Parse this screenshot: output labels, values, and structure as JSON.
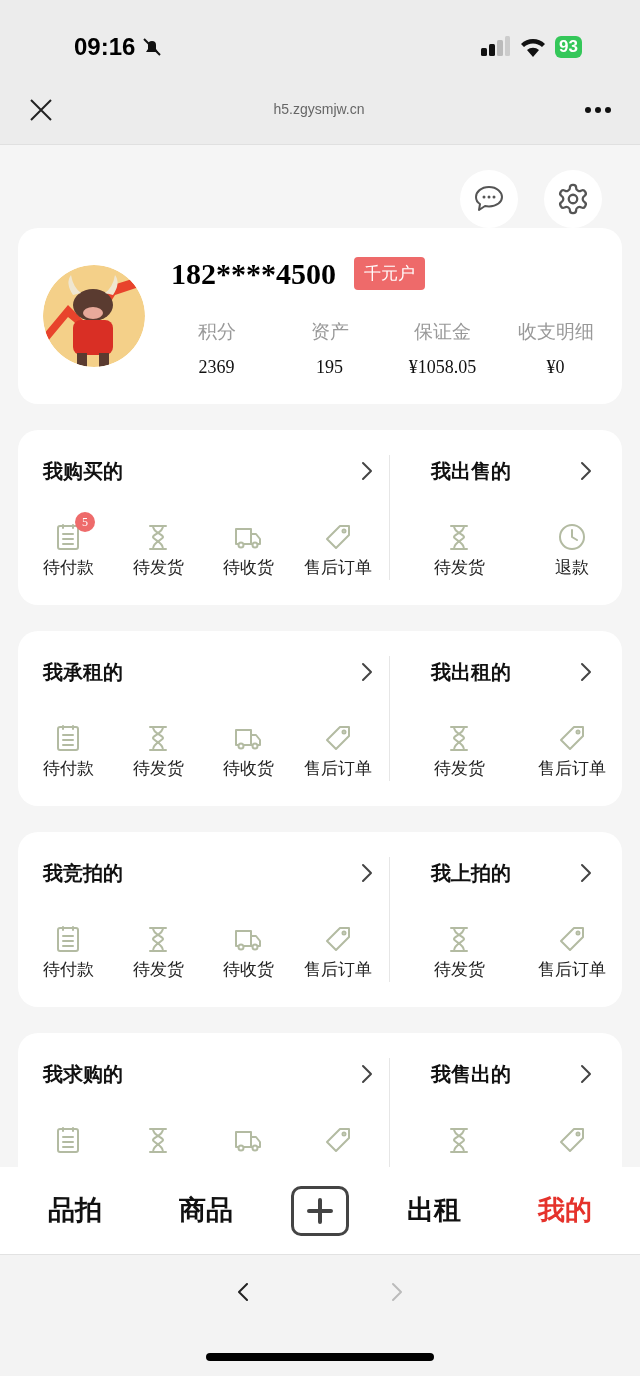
{
  "status_bar": {
    "time": "09:16",
    "battery": "93"
  },
  "browser": {
    "url": "h5.zgysmjw.cn"
  },
  "profile": {
    "name": "182****4500",
    "badge": "千元户",
    "stats": [
      {
        "label": "积分",
        "value": "2369"
      },
      {
        "label": "资产",
        "value": "195"
      },
      {
        "label": "保证金",
        "value": "¥1058.05"
      },
      {
        "label": "收支明细",
        "value": "¥0"
      }
    ]
  },
  "cards": [
    {
      "left": {
        "title": "我购买的",
        "items": [
          {
            "kind": "list",
            "label": "待付款",
            "badge": "5"
          },
          {
            "kind": "hourglass",
            "label": "待发货"
          },
          {
            "kind": "truck",
            "label": "待收货"
          },
          {
            "kind": "tag",
            "label": "售后订单"
          }
        ]
      },
      "right": {
        "title": "我出售的",
        "items": [
          {
            "kind": "hourglass",
            "label": "待发货"
          },
          {
            "kind": "clock",
            "label": "退款"
          }
        ]
      }
    },
    {
      "left": {
        "title": "我承租的",
        "items": [
          {
            "kind": "list",
            "label": "待付款"
          },
          {
            "kind": "hourglass",
            "label": "待发货"
          },
          {
            "kind": "truck",
            "label": "待收货"
          },
          {
            "kind": "tag",
            "label": "售后订单"
          }
        ]
      },
      "right": {
        "title": "我出租的",
        "items": [
          {
            "kind": "hourglass",
            "label": "待发货"
          },
          {
            "kind": "tag",
            "label": "售后订单"
          }
        ]
      }
    },
    {
      "left": {
        "title": "我竞拍的",
        "items": [
          {
            "kind": "list",
            "label": "待付款"
          },
          {
            "kind": "hourglass",
            "label": "待发货"
          },
          {
            "kind": "truck",
            "label": "待收货"
          },
          {
            "kind": "tag",
            "label": "售后订单"
          }
        ]
      },
      "right": {
        "title": "我上拍的",
        "items": [
          {
            "kind": "hourglass",
            "label": "待发货"
          },
          {
            "kind": "tag",
            "label": "售后订单"
          }
        ]
      }
    },
    {
      "left": {
        "title": "我求购的",
        "items": [
          {
            "kind": "list"
          },
          {
            "kind": "hourglass"
          },
          {
            "kind": "truck"
          },
          {
            "kind": "tag"
          }
        ]
      },
      "right": {
        "title": "我售出的",
        "items": [
          {
            "kind": "hourglass"
          },
          {
            "kind": "tag"
          }
        ]
      }
    }
  ],
  "tab_bar": [
    {
      "kind": "text",
      "label": "品拍",
      "selected": false
    },
    {
      "kind": "text",
      "label": "商品",
      "selected": false
    },
    {
      "kind": "add",
      "selected": false
    },
    {
      "kind": "text",
      "label": "出租",
      "selected": false
    },
    {
      "kind": "text",
      "label": "我的",
      "selected": true
    }
  ],
  "browser_nav": {
    "back_disabled": false,
    "forward_disabled": true
  }
}
